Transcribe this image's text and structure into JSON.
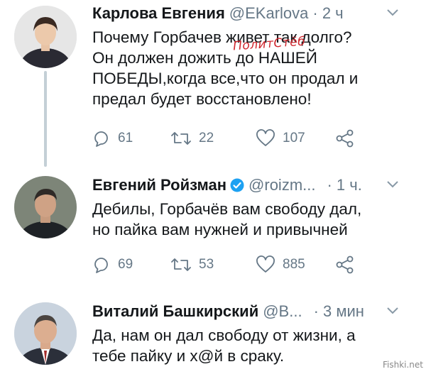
{
  "tweets": [
    {
      "name": "Карлова Евгения",
      "handle": "@EKarlova",
      "time": "· 2 ч",
      "verified": false,
      "lines": [
        "Почему Горбачев живет так долго?",
        "Он должен дожить до НАШЕЙ",
        "ПОБЕДЫ,когда все,что он продал и",
        "предал будет восстановлено!"
      ],
      "replies": "61",
      "retweets": "22",
      "likes": "107"
    },
    {
      "name": "Евгений Ройзман",
      "handle": "@roizm...",
      "time": "· 1 ч.",
      "verified": true,
      "lines": [
        "Дебилы, Горбачёв вам свободу дал,",
        "но пайка вам нужней и привычней"
      ],
      "replies": "69",
      "retweets": "53",
      "likes": "885"
    },
    {
      "name": "Виталий Башкирский",
      "handle": "@В...",
      "time": "· 3 мин",
      "verified": false,
      "lines": [
        "Да, нам он дал свободу от жизни, а",
        "тебе пайку и х@й в сраку."
      ]
    }
  ],
  "watermark": "ПолитСтёб",
  "site_badge": "Fishki.net",
  "colors": {
    "muted": "#657786",
    "verified": "#1da1f2",
    "thread_line": "#c4cfd6"
  }
}
